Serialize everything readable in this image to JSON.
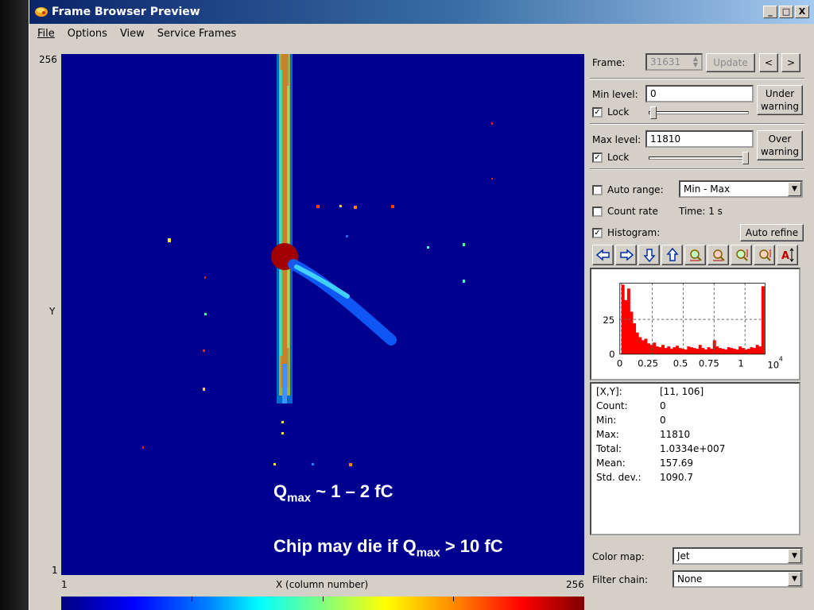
{
  "window": {
    "title": "Frame Browser Preview",
    "controls": [
      "_",
      "□",
      "X"
    ]
  },
  "menu": [
    "File",
    "Options",
    "View",
    "Service Frames"
  ],
  "plot": {
    "y_top": "256",
    "y_bottom": "1",
    "y_label": "Y",
    "x_left": "1",
    "x_right": "256",
    "x_label": "X (column number)",
    "background_color": "#00008f"
  },
  "overlay": {
    "line1_prefix": "Q",
    "line1_sub": "max",
    "line1_suffix": " ~ 1 – 2 fC",
    "line2_prefix": "Chip may die if Q",
    "line2_sub": "max",
    "line2_suffix": " > 10 fC"
  },
  "panel": {
    "frame_label": "Frame:",
    "frame_value": "31631",
    "update_label": "Update",
    "prev_label": "<",
    "next_label": ">",
    "min_level_label": "Min level:",
    "min_level_value": "0",
    "under_warning_label": "Under warning",
    "lock_label": "Lock",
    "max_level_label": "Max level:",
    "max_level_value": "11810",
    "over_warning_label": "Over warning",
    "auto_range_label": "Auto range:",
    "auto_range_value": "Min - Max",
    "count_rate_label": "Count rate",
    "time_label": "Time: 1 s",
    "histogram_label": "Histogram:",
    "auto_refine_label": "Auto refine",
    "color_map_label": "Color map:",
    "color_map_value": "Jet",
    "filter_chain_label": "Filter chain:",
    "filter_chain_value": "None",
    "checks": {
      "min_lock": true,
      "max_lock": true,
      "auto_range": false,
      "count_rate": false,
      "histogram": true
    }
  },
  "histogram": {
    "y_ticks": [
      "25",
      "0"
    ],
    "x_ticks": [
      "0",
      "0.25",
      "0.5",
      "0.75",
      "1",
      "10"
    ],
    "x_exp": "4",
    "bar_color": "#ff0000"
  },
  "stats": [
    {
      "k": "[X,Y]:",
      "v": "[11, 106]"
    },
    {
      "k": "Count:",
      "v": "0"
    },
    {
      "k": "Min:",
      "v": "0"
    },
    {
      "k": "Max:",
      "v": "11810"
    },
    {
      "k": "Total:",
      "v": "1.0334e+007"
    },
    {
      "k": "Mean:",
      "v": "157.69"
    },
    {
      "k": "Std. dev.:",
      "v": "1090.7"
    }
  ]
}
